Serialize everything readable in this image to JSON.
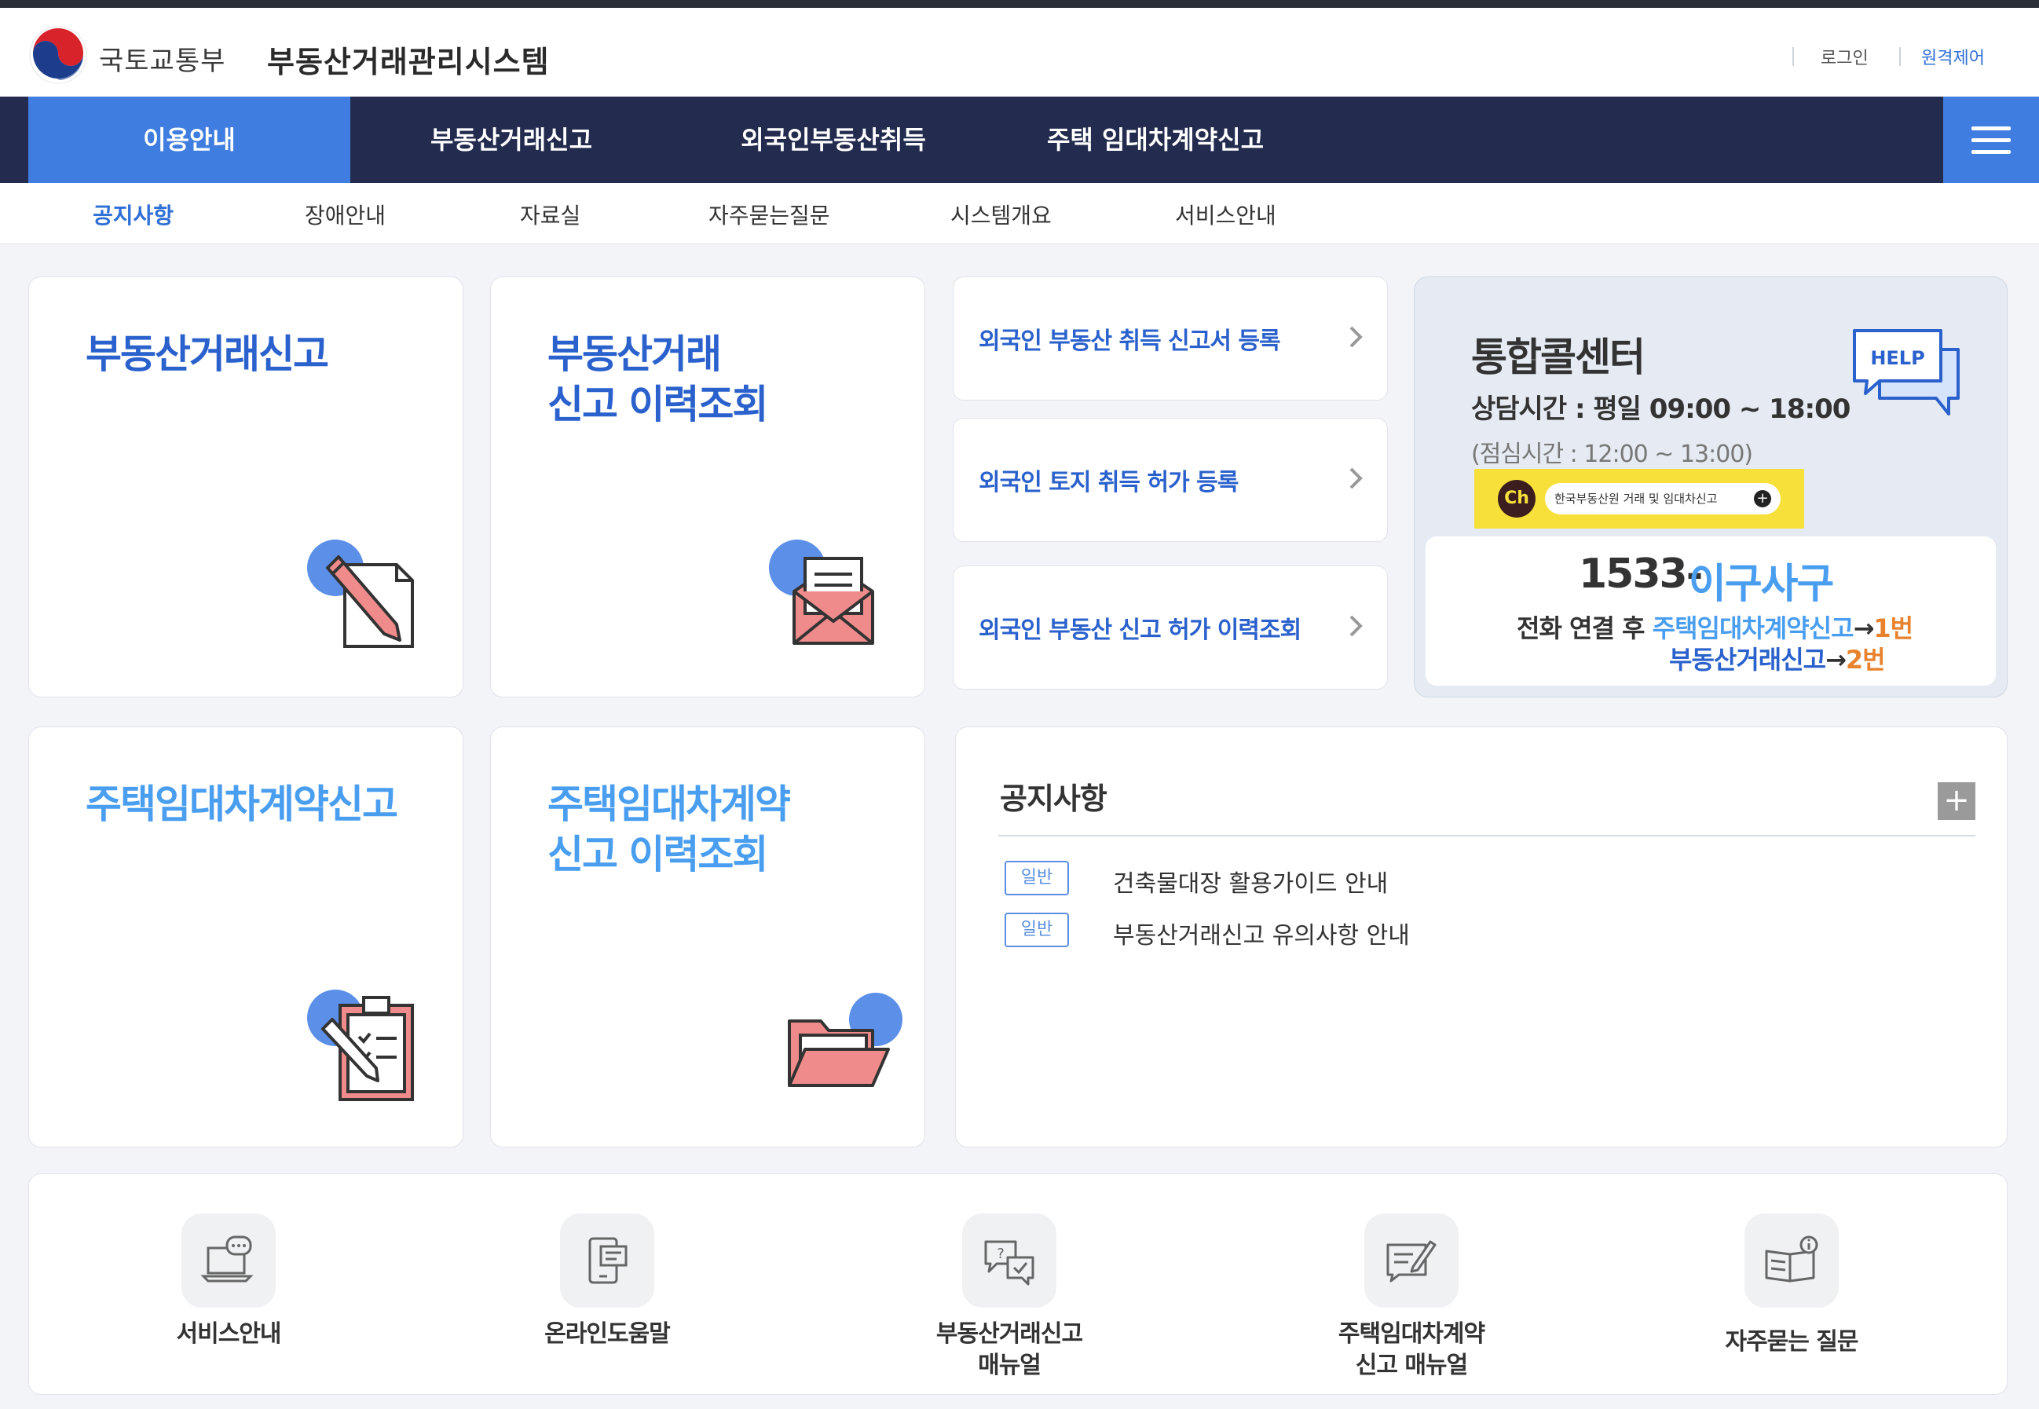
{
  "header": {
    "ministry": "국토교통부",
    "system_title": "부동산거래관리시스템",
    "login": "로그인",
    "remote": "원격제어"
  },
  "gnb": {
    "items": [
      "이용안내",
      "부동산거래신고",
      "외국인부동산취득",
      "주택 임대차계약신고"
    ],
    "active_index": 0
  },
  "subnav": {
    "items": [
      "공지사항",
      "장애안내",
      "자료실",
      "자주묻는질문",
      "시스템개요",
      "서비스안내"
    ],
    "active_index": 0
  },
  "cards": {
    "report": "부동산거래신고",
    "history_line1": "부동산거래",
    "history_line2": "신고 이력조회",
    "lease": "주택임대차계약신고",
    "lease_history_line1": "주택임대차계약",
    "lease_history_line2": "신고 이력조회"
  },
  "foreign_links": [
    "외국인 부동산 취득 신고서 등록",
    "외국인 토지 취득 허가 등록",
    "외국인 부동산 신고 허가 이력조회"
  ],
  "callcenter": {
    "title": "통합콜센터",
    "hours": "상담시간 : 평일 09:00 ~ 18:00",
    "lunch": "(점심시간 : 12:00 ~ 13:00)",
    "kakao_ch": "Ch",
    "kakao_label": "한국부동산원 거래 및 임대차신고",
    "help_badge": "HELP",
    "phone_prefix": "1533-",
    "phone_word": "이구사구",
    "line1_prefix": "전화 연결 후 ",
    "line1_service": "주택임대차계약신고",
    "arrow": "→",
    "line1_number": "1번",
    "line2_service": "부동산거래신고",
    "line2_number": "2번"
  },
  "notice": {
    "title": "공지사항",
    "more": "+",
    "items": [
      {
        "tag": "일반",
        "text": "건축물대장 활용가이드 안내"
      },
      {
        "tag": "일반",
        "text": "부동산거래신고 유의사항 안내"
      }
    ]
  },
  "quick": [
    {
      "line1": "서비스안내",
      "line2": ""
    },
    {
      "line1": "온라인도움말",
      "line2": ""
    },
    {
      "line1": "부동산거래신고",
      "line2": "매뉴얼"
    },
    {
      "line1": "주택임대차계약",
      "line2": "신고 매뉴얼"
    },
    {
      "line1": "자주묻는 질문",
      "line2": ""
    }
  ],
  "colors": {
    "navy": "#232b4e",
    "accent_blue": "#3f7de0",
    "title_blue": "#2a61cc",
    "light_blue": "#4a9ef0",
    "orange": "#e8822d",
    "kakao_yellow": "#f7e03a"
  }
}
